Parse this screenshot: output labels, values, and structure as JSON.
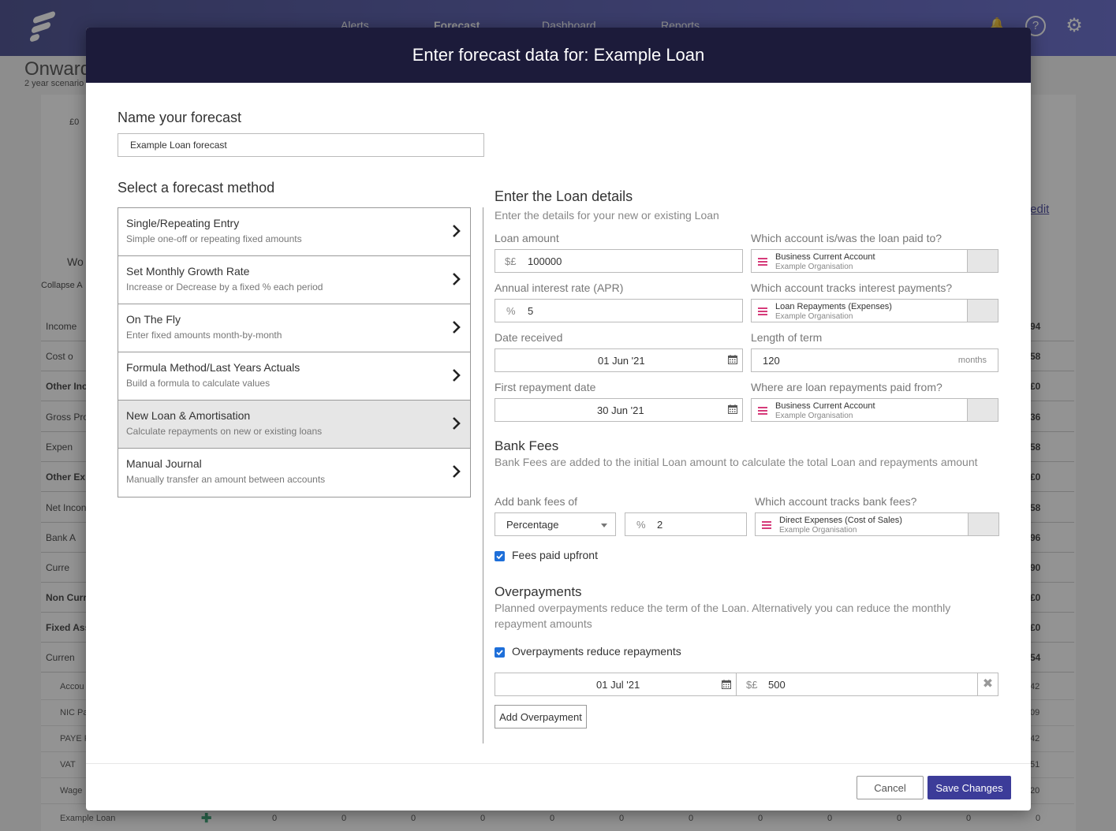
{
  "background": {
    "nav": [
      "Alerts",
      "Forecast",
      "Dashboard",
      "Reports"
    ],
    "page_title": "Onwards",
    "page_subtitle": "2 year scenario",
    "chart_zero": "£0",
    "edit_link": "/edit",
    "work_label": "Wo",
    "collapse_label": "Collapse A",
    "rows": [
      {
        "label": "Income",
        "value": "94"
      },
      {
        "label": "Cost o",
        "value": "58"
      },
      {
        "label": "Other Inc",
        "value": "£0"
      },
      {
        "label": "Gross Pro",
        "value": "36"
      },
      {
        "label": "Expen",
        "value": "58"
      },
      {
        "label": "Other Ex",
        "value": "£0"
      },
      {
        "label": "Net Incon",
        "value": "58"
      },
      {
        "label": "Bank A",
        "value": "96"
      },
      {
        "label": "Curre",
        "value": "90"
      },
      {
        "label": "Non Curr",
        "value": "£0"
      },
      {
        "label": "Fixed Ass",
        "value": "£0"
      },
      {
        "label": "Curren",
        "value": "54"
      }
    ],
    "sub_rows": [
      {
        "label": "Accou",
        "value": "42"
      },
      {
        "label": "NIC Pa",
        "value": "09"
      },
      {
        "label": "PAYE F",
        "value": "42"
      },
      {
        "label": "VAT",
        "value": "51"
      },
      {
        "label": "Wage",
        "value": "20"
      }
    ],
    "last_row": {
      "label": "Example Loan",
      "zeros": [
        "0",
        "0",
        "0",
        "0",
        "0",
        "0",
        "0",
        "0",
        "0",
        "0",
        "0",
        "0"
      ]
    }
  },
  "modal": {
    "title": "Enter forecast data for: Example Loan",
    "name_heading": "Name your forecast",
    "name_value": "Example Loan forecast",
    "method_heading": "Select a forecast method",
    "methods": [
      {
        "title": "Single/Repeating Entry",
        "desc": "Simple one-off or repeating fixed amounts"
      },
      {
        "title": "Set Monthly Growth Rate",
        "desc": "Increase or Decrease by a fixed % each period"
      },
      {
        "title": "On The Fly",
        "desc": "Enter fixed amounts month-by-month"
      },
      {
        "title": "Formula Method/Last Years Actuals",
        "desc": "Build a formula to calculate values"
      },
      {
        "title": "New Loan & Amortisation",
        "desc": "Calculate repayments on new or existing loans"
      },
      {
        "title": "Manual Journal",
        "desc": "Manually transfer an amount between accounts"
      }
    ],
    "selected_method": "New Loan & Amortisation",
    "loan": {
      "heading": "Enter the Loan details",
      "subheading": "Enter the details for your new or existing Loan",
      "amount_label": "Loan amount",
      "amount_prefix": "$£",
      "amount_value": "100000",
      "paid_to_label": "Which account is/was the loan paid to?",
      "paid_to_account": "Business Current Account",
      "paid_to_org": "Example Organisation",
      "apr_label": "Annual interest rate (APR)",
      "apr_prefix": "%",
      "apr_value": "5",
      "interest_label": "Which account tracks interest payments?",
      "interest_account": "Loan Repayments  (Expenses)",
      "interest_org": "Example Organisation",
      "date_received_label": "Date received",
      "date_received_value": "01 Jun '21",
      "term_label": "Length of term",
      "term_value": "120",
      "term_suffix": "months",
      "first_repay_label": "First repayment date",
      "first_repay_value": "30 Jun '21",
      "repay_from_label": "Where are loan repayments paid from?",
      "repay_from_account": "Business Current Account",
      "repay_from_org": "Example Organisation"
    },
    "fees": {
      "heading": "Bank Fees",
      "desc": "Bank Fees are added to the initial Loan amount to calculate the total Loan and repayments amount",
      "add_label": "Add bank fees of",
      "type_value": "Percentage",
      "pct_prefix": "%",
      "pct_value": "2",
      "account_label": "Which account tracks bank fees?",
      "account": "Direct Expenses  (Cost of Sales)",
      "org": "Example Organisation",
      "upfront_label": "Fees paid upfront",
      "upfront_checked": true
    },
    "overpayments": {
      "heading": "Overpayments",
      "desc": "Planned overpayments reduce the term of the Loan. Alternatively you can reduce the monthly repayment amounts",
      "reduce_label": "Overpayments reduce repayments",
      "reduce_checked": true,
      "row_date": "01 Jul '21",
      "row_prefix": "$£",
      "row_amount": "500",
      "add_button": "Add Overpayment"
    },
    "cancel_label": "Cancel",
    "save_label": "Save Changes"
  },
  "colors": {
    "header": "#1c1b3a",
    "primary_button": "#3c3c99",
    "account_icon": "#d63b7a",
    "checkbox": "#1e6fd9"
  }
}
